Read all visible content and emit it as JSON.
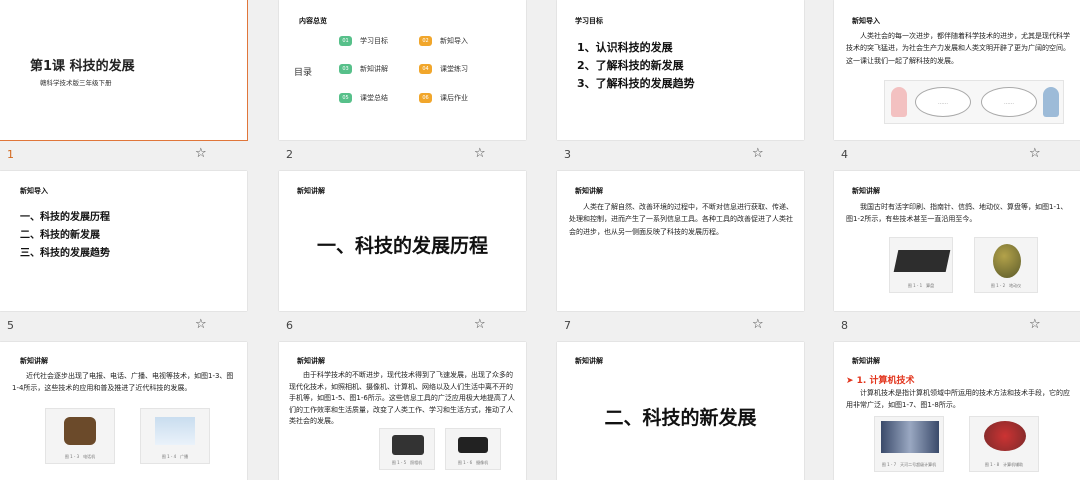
{
  "slides": [
    {
      "number": "1",
      "title": "第1课 科技的发展",
      "subtitle": "赣科学技术版三年级下册"
    },
    {
      "number": "2",
      "header": "内容总览",
      "toc_label": "目录",
      "items": [
        {
          "badge": "01",
          "label": "学习目标"
        },
        {
          "badge": "02",
          "label": "新知导入"
        },
        {
          "badge": "03",
          "label": "新知讲解"
        },
        {
          "badge": "04",
          "label": "课堂练习"
        },
        {
          "badge": "05",
          "label": "课堂总结"
        },
        {
          "badge": "06",
          "label": "课后作业"
        }
      ]
    },
    {
      "number": "3",
      "header": "学习目标",
      "items": [
        "1、认识科技的发展",
        "2、了解科技的新发展",
        "3、了解科技的发展趋势"
      ]
    },
    {
      "number": "4",
      "header": "新知导入",
      "body": "人类社会的每一次进步，都伴随着科学技术的进步，尤其是现代科学技术的突飞猛进，为社会生产力发展和人类文明开辟了更为广阔的空间。这一课让我们一起了解科技的发展。",
      "bubble_left": "……",
      "bubble_right": "……"
    },
    {
      "number": "5",
      "header": "新知导入",
      "items": [
        "一、科技的发展历程",
        "二、科技的新发展",
        "三、科技的发展趋势"
      ]
    },
    {
      "number": "6",
      "header": "新知讲解",
      "big": "一、科技的发展历程"
    },
    {
      "number": "7",
      "header": "新知讲解",
      "body": "人类在了解自然、改善环境的过程中，不断对信息进行获取、传递、处理和控制，进而产生了一系列信息工具。各种工具的改善促进了人类社会的进步，也从另一侧面反映了科技的发展历程。"
    },
    {
      "number": "8",
      "header": "新知讲解",
      "body": "我国古时有活字印刷、指南针、信鸽、地动仪、算盘等，如图1-1、图1-2所示，有些技术甚至一直沿用至今。",
      "captions": [
        "图 1 - 1　算盘",
        "图 1 - 2　地动仪"
      ]
    },
    {
      "number": "",
      "header": "新知讲解",
      "body": "近代社会逐步出现了电报、电话、广播、电视等技术，如图1-3、图1-4所示，这些技术的应用和普及推进了近代科技的发展。",
      "captions": [
        "图 1 - 3　电话机",
        "图 1 - 4　广播"
      ]
    },
    {
      "number": "",
      "header": "新知讲解",
      "body": "由于科学技术的不断进步，现代技术得到了飞速发展，出现了众多的现代化技术，如照相机、摄像机、计算机、网络以及人们生活中离不开的手机等，如图1-5、图1-6所示。这些信息工具的广泛应用极大地提高了人们的工作效率和生活质量，改变了人类工作、学习和生活方式，推动了人类社会的发展。",
      "captions": [
        "图 1 - 5　照相机",
        "图 1 - 6　摄像机"
      ]
    },
    {
      "number": "",
      "header": "新知讲解",
      "big": "二、科技的新发展"
    },
    {
      "number": "",
      "header": "新知讲解",
      "section": "➤ 1. 计算机技术",
      "body": "计算机技术是指计算机领域中所运用的技术方法和技术手段，它的应用非常广泛，如图1-7、图1-8所示。",
      "captions": [
        "图 1 - 7　天河二号超级计算机",
        "图 1 - 8　计算机辅助"
      ]
    }
  ],
  "star_glyph": "☆",
  "colors": {
    "accent": "#e0763a",
    "red": "#e2331b",
    "green": "#57c08a",
    "orange": "#f1a62b"
  }
}
